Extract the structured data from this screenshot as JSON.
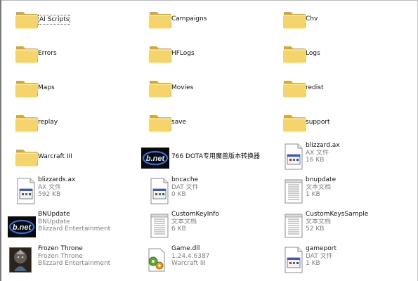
{
  "colors": {
    "folder": "#f5d56b",
    "folder_dark": "#d9a82b",
    "bnet_blue": "#2d6fd6",
    "subtext": "#7f7f7f"
  },
  "items": [
    {
      "name": "AI Scripts",
      "selected": true,
      "icon": "folder-icon"
    },
    {
      "name": "Campaigns",
      "icon": "folder-icon"
    },
    {
      "name": "Chv",
      "icon": "folder-icon"
    },
    {
      "name": "Errors",
      "icon": "folder-icon"
    },
    {
      "name": "HFLogs",
      "icon": "folder-icon"
    },
    {
      "name": "Logs",
      "icon": "folder-icon"
    },
    {
      "name": "Maps",
      "icon": "folder-icon"
    },
    {
      "name": "Movies",
      "icon": "folder-icon"
    },
    {
      "name": "redist",
      "icon": "folder-icon"
    },
    {
      "name": "replay",
      "icon": "folder-icon"
    },
    {
      "name": "save",
      "icon": "folder-icon"
    },
    {
      "name": "support",
      "icon": "folder-icon"
    },
    {
      "name": "Warcraft III",
      "icon": "folder-icon"
    },
    {
      "name": "766 DOTA专用魔兽版本转换器",
      "icon": "bnet-logo-icon"
    },
    {
      "name": "blizzard.ax",
      "line2": "AX 文件",
      "line3": "16 KB",
      "icon": "generic-file-icon"
    },
    {
      "name": "blizzards.ax",
      "line2": "AX 文件",
      "line3": "592 KB",
      "icon": "generic-file-icon"
    },
    {
      "name": "bncache",
      "line2": "DAT 文件",
      "line3": "0 KB",
      "icon": "generic-file-icon"
    },
    {
      "name": "bnupdate",
      "line2": "文本文档",
      "line3": "1 KB",
      "icon": "text-document-icon"
    },
    {
      "name": "BNUpdate",
      "line2": "BNUpdate",
      "line3": "Blizzard Entertainment",
      "icon": "bnet-logo-icon"
    },
    {
      "name": "CustomKeyInfo",
      "line2": "文本文档",
      "line3": "6 KB",
      "icon": "text-document-icon"
    },
    {
      "name": "CustomKeysSample",
      "line2": "文本文档",
      "line3": "52 KB",
      "icon": "text-document-icon"
    },
    {
      "name": "Frozen Throne",
      "line2": "Frozen Throne",
      "line3": "Blizzard Entertainment",
      "icon": "frozen-throne-icon"
    },
    {
      "name": "Game.dll",
      "line2": "1.24.4.6387",
      "line3": "Warcraft III",
      "icon": "dll-gear-icon"
    },
    {
      "name": "gameport",
      "line2": "DAT 文件",
      "line3": "1 KB",
      "icon": "generic-file-icon"
    }
  ]
}
